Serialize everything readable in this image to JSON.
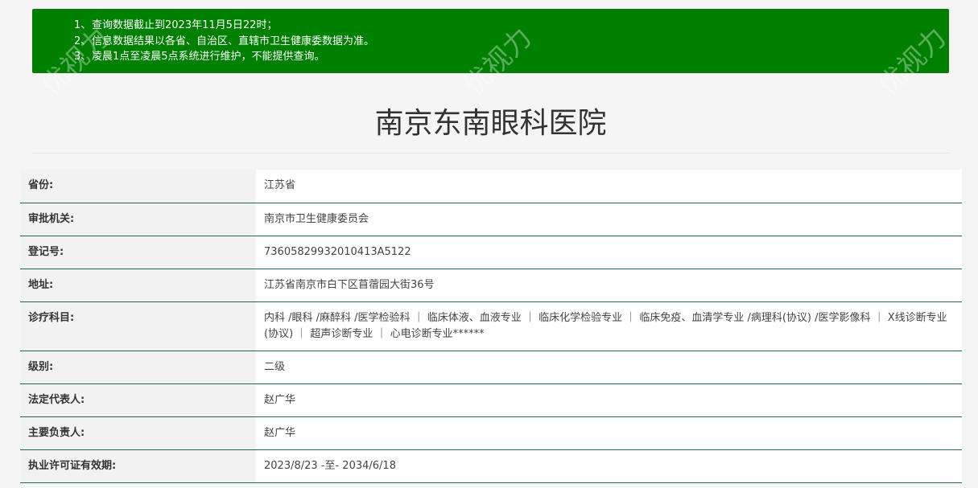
{
  "notice": {
    "items": [
      {
        "num": "1、",
        "text": "查询数据截止到2023年11月5日22时；"
      },
      {
        "num": "2、",
        "text": "信息数据结果以各省、自治区、直辖市卫生健康委数据为准。"
      },
      {
        "num": "3、",
        "text": "凌晨1点至凌晨5点系统进行维护，不能提供查询。"
      }
    ]
  },
  "watermark": {
    "text": "优视力",
    "sub": "89yo.com"
  },
  "hospital": {
    "name": "南京东南眼科医院"
  },
  "fields": [
    {
      "label": "省份:",
      "value": "江苏省"
    },
    {
      "label": "审批机关:",
      "value": "南京市卫生健康委员会"
    },
    {
      "label": "登记号:",
      "value": "73605829932010413A5122"
    },
    {
      "label": "地址:",
      "value": "江苏省南京市白下区苜蓿园大街36号"
    },
    {
      "label": "诊疗科目:",
      "value": "内科 /眼科 /麻醉科 /医学检验科 ｜ 临床体液、血液专业 ｜ 临床化学检验专业 ｜ 临床免疫、血清学专业 /病理科(协议) /医学影像科 ｜ X线诊断专业(协议) ｜ 超声诊断专业 ｜ 心电诊断专业******"
    },
    {
      "label": "级别:",
      "value": "二级"
    },
    {
      "label": "法定代表人:",
      "value": "赵广华"
    },
    {
      "label": "主要负责人:",
      "value": "赵广华"
    },
    {
      "label": "执业许可证有效期:",
      "value": "2023/8/23 -至- 2034/6/18"
    }
  ],
  "colors": {
    "notice_bg": "#008000",
    "row_border": "#1f6b50"
  }
}
